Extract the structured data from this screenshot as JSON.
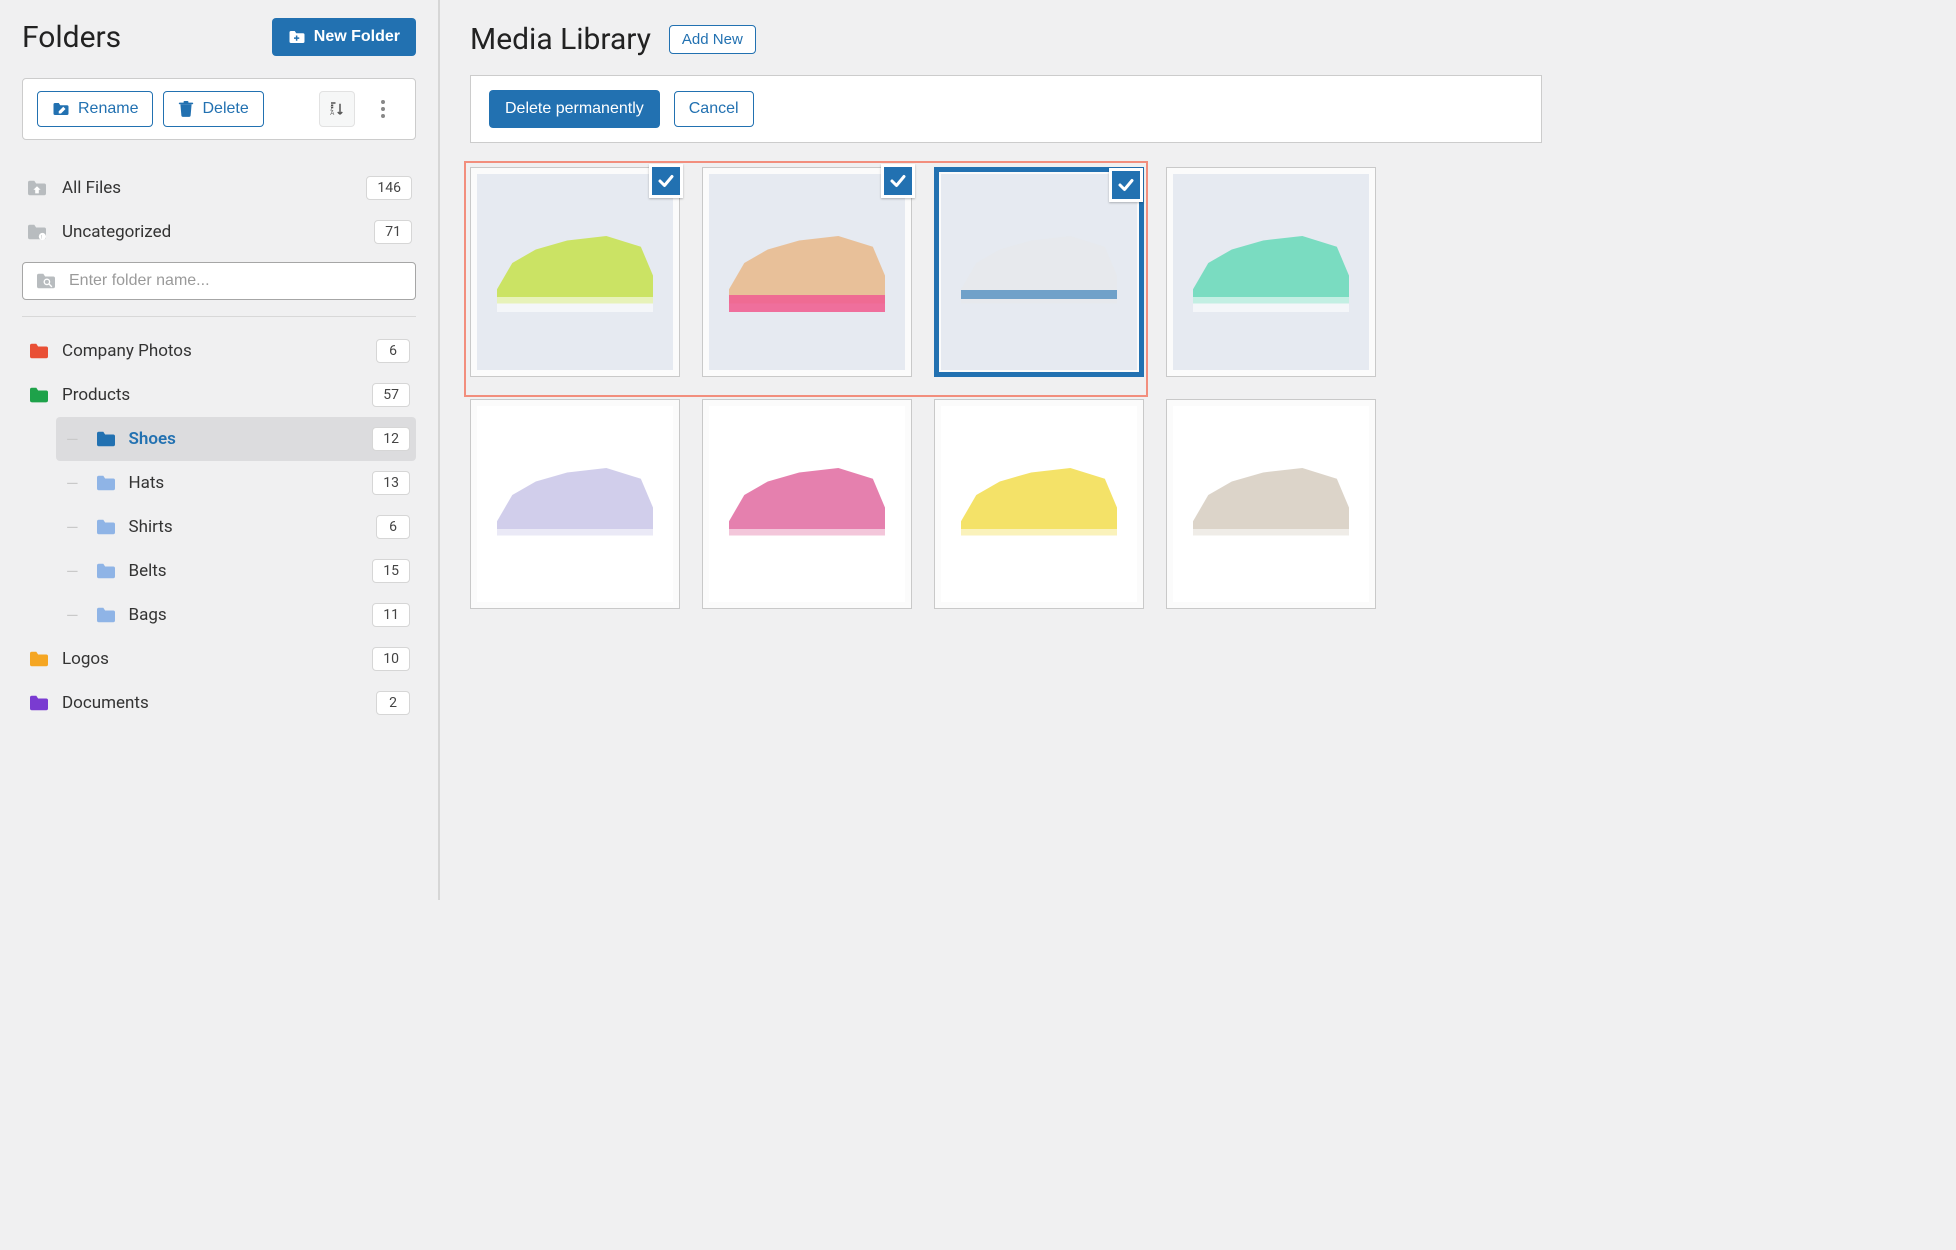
{
  "sidebar": {
    "title": "Folders",
    "new_folder_label": "New Folder",
    "rename_label": "Rename",
    "delete_label": "Delete",
    "all_files_label": "All Files",
    "all_files_count": "146",
    "uncategorized_label": "Uncategorized",
    "uncategorized_count": "71",
    "search_placeholder": "Enter folder name..."
  },
  "tree": {
    "items": [
      {
        "label": "Company Photos",
        "count": "6",
        "color": "#e94f35"
      },
      {
        "label": "Products",
        "count": "57",
        "color": "#1fa24a",
        "open": true,
        "children": [
          {
            "label": "Shoes",
            "count": "12",
            "color": "#2271b1",
            "active": true
          },
          {
            "label": "Hats",
            "count": "13",
            "color": "#8fb4e6"
          },
          {
            "label": "Shirts",
            "count": "6",
            "color": "#8fb4e6"
          },
          {
            "label": "Belts",
            "count": "15",
            "color": "#8fb4e6"
          },
          {
            "label": "Bags",
            "count": "11",
            "color": "#8fb4e6"
          }
        ]
      },
      {
        "label": "Logos",
        "count": "10",
        "color": "#f5a623"
      },
      {
        "label": "Documents",
        "count": "2",
        "color": "#7a3bd1"
      }
    ]
  },
  "main": {
    "title": "Media Library",
    "add_new_label": "Add New",
    "delete_permanently_label": "Delete permanently",
    "cancel_label": "Cancel"
  },
  "media": {
    "items": [
      {
        "selected": true,
        "strong": false,
        "shoe": "s1"
      },
      {
        "selected": true,
        "strong": false,
        "shoe": "s2"
      },
      {
        "selected": true,
        "strong": true,
        "shoe": "s3"
      },
      {
        "selected": false,
        "strong": false,
        "shoe": "s4"
      },
      {
        "selected": false,
        "strong": false,
        "shoe": "s5",
        "row": 2
      },
      {
        "selected": false,
        "strong": false,
        "shoe": "s6",
        "row": 2
      },
      {
        "selected": false,
        "strong": false,
        "shoe": "s7",
        "row": 2
      },
      {
        "selected": false,
        "strong": false,
        "shoe": "s8",
        "row": 2
      }
    ]
  }
}
